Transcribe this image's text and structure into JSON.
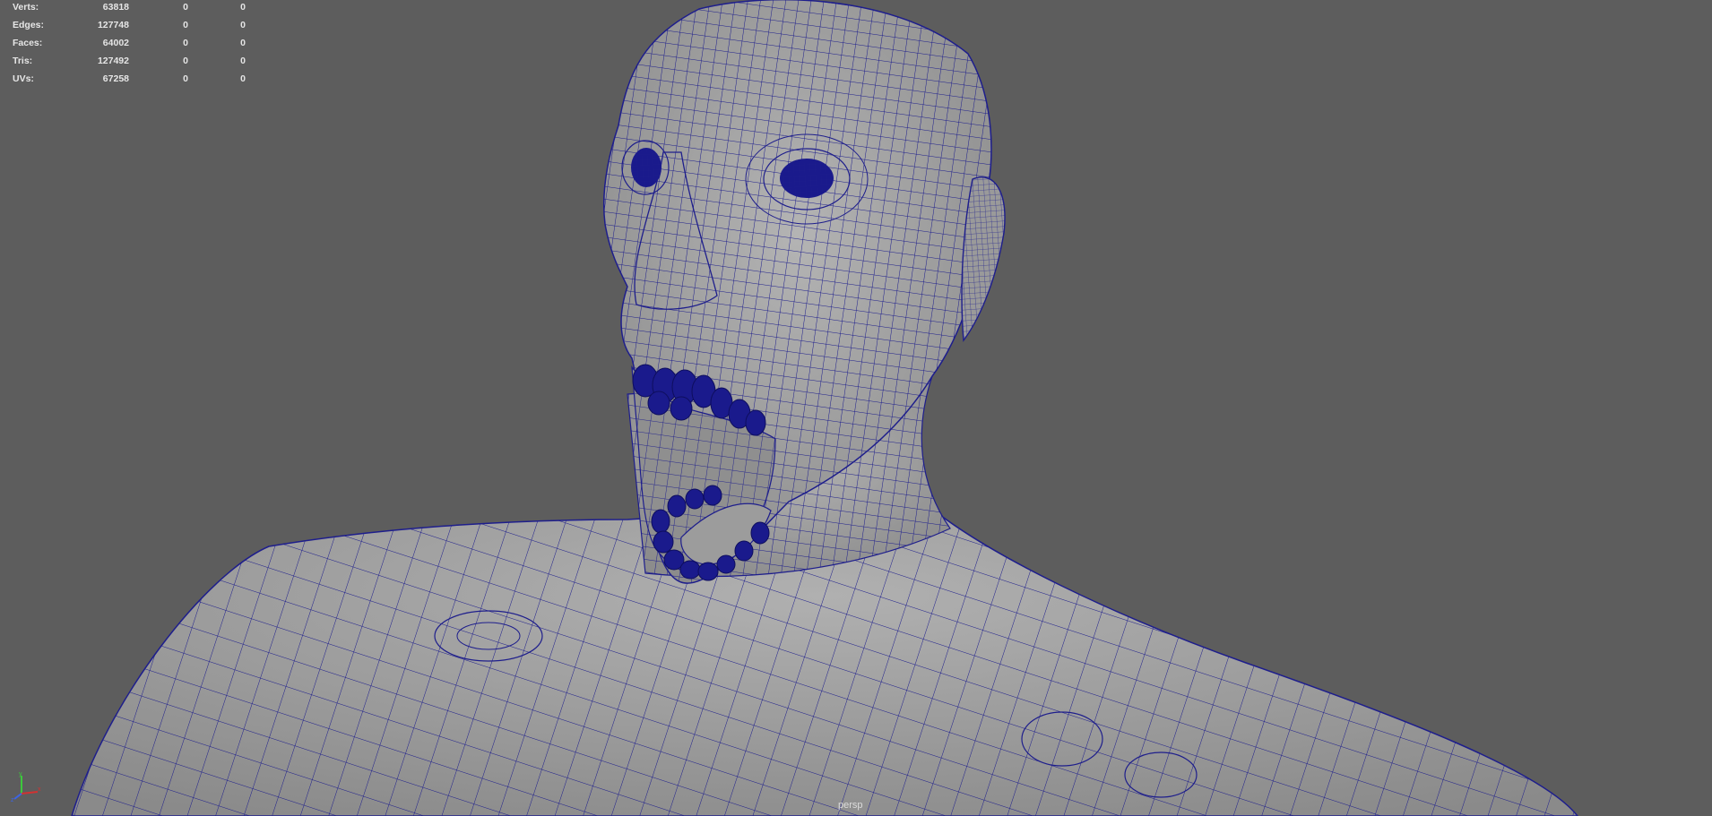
{
  "hud": {
    "rows": [
      {
        "label": "Verts:",
        "total": "63818",
        "selected": "0",
        "comp": "0"
      },
      {
        "label": "Edges:",
        "total": "127748",
        "selected": "0",
        "comp": "0"
      },
      {
        "label": "Faces:",
        "total": "64002",
        "selected": "0",
        "comp": "0"
      },
      {
        "label": "Tris:",
        "total": "127492",
        "selected": "0",
        "comp": "0"
      },
      {
        "label": "UVs:",
        "total": "67258",
        "selected": "0",
        "comp": "0"
      }
    ]
  },
  "viewport": {
    "camera": "persp",
    "background_color": "#5d5d5d",
    "mesh_color": "#a8a8a8",
    "wire_color": "#1a1a8a"
  },
  "axis_gizmo": {
    "x_color": "#d23232",
    "y_color": "#3cc83c",
    "z_color": "#3c64e6"
  }
}
